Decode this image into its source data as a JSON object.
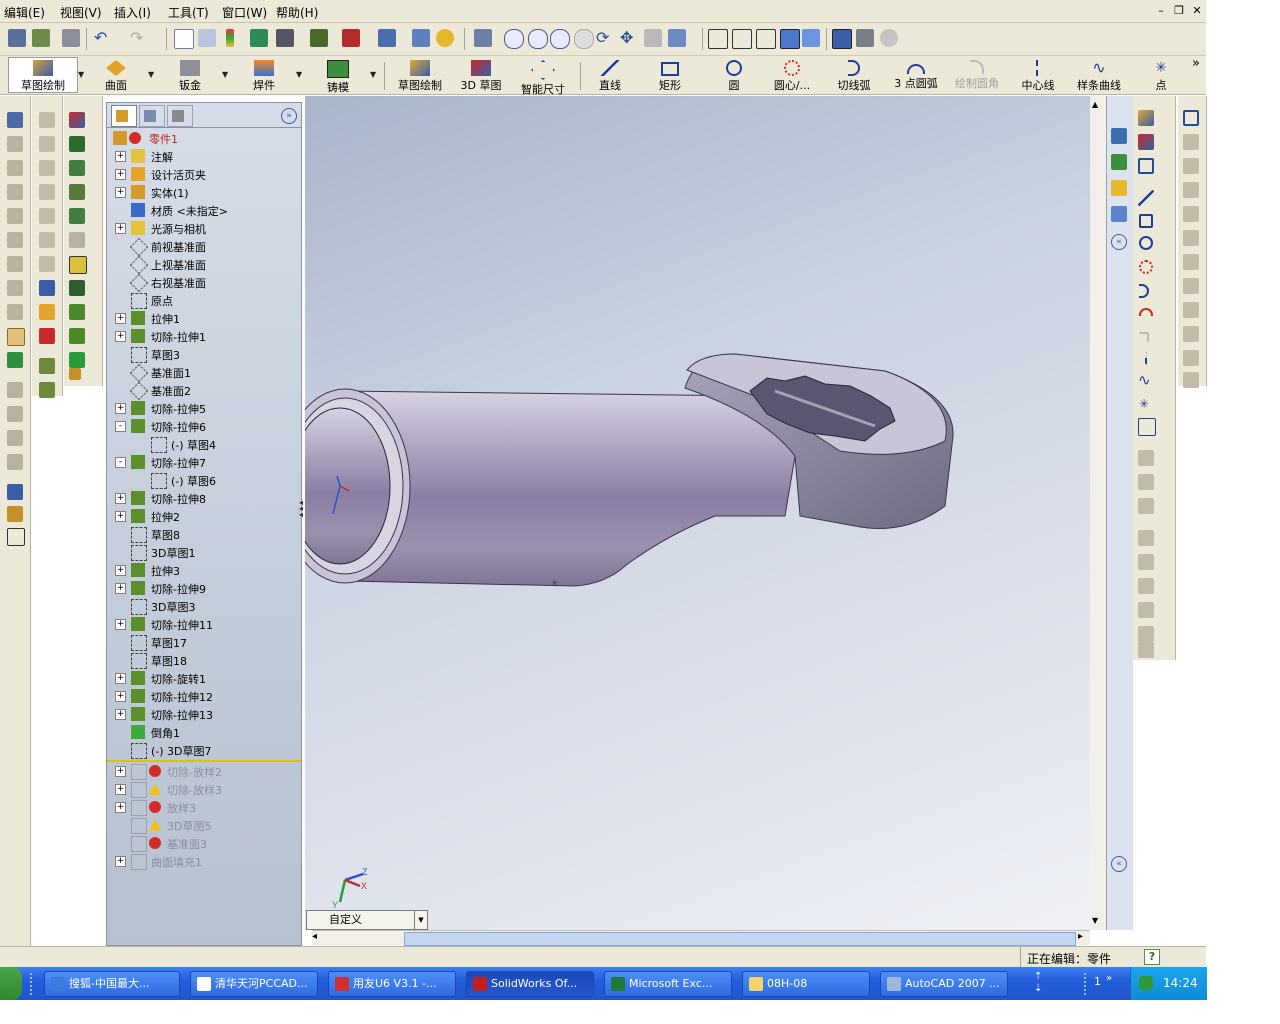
{
  "menu": [
    "编辑(E)",
    "视图(V)",
    "插入(I)",
    "工具(T)",
    "窗口(W)",
    "帮助(H)"
  ],
  "command_manager": {
    "tabs": [
      "草图绘制",
      "曲面",
      "钣金",
      "焊件",
      "铸模"
    ],
    "sketch_tools": [
      "草图绘制",
      "3D 草图",
      "智能尺寸",
      "直线",
      "矩形",
      "圆",
      "圆心/...",
      "切线弧",
      "3 点圆弧",
      "绘制圆角",
      "中心线",
      "样条曲线",
      "点"
    ],
    "disabled_tool": "绘制圆角",
    "more": "»"
  },
  "feature_tree": {
    "root": "零件1",
    "items": [
      {
        "label": "注解",
        "exp": "+",
        "icon": "annotation"
      },
      {
        "label": "设计活页夹",
        "exp": "+",
        "icon": "binder"
      },
      {
        "label": "实体(1)",
        "exp": "+",
        "icon": "solid"
      },
      {
        "label": "材质 <未指定>",
        "exp": "",
        "icon": "material"
      },
      {
        "label": "光源与相机",
        "exp": "+",
        "icon": "lights"
      },
      {
        "label": "前视基准面",
        "exp": "",
        "icon": "plane"
      },
      {
        "label": "上视基准面",
        "exp": "",
        "icon": "plane"
      },
      {
        "label": "右视基准面",
        "exp": "",
        "icon": "plane"
      },
      {
        "label": "原点",
        "exp": "",
        "icon": "origin"
      },
      {
        "label": "拉伸1",
        "exp": "+",
        "icon": "extrude"
      },
      {
        "label": "切除-拉伸1",
        "exp": "+",
        "icon": "cut"
      },
      {
        "label": "草图3",
        "exp": "",
        "icon": "sketch"
      },
      {
        "label": "基准面1",
        "exp": "",
        "icon": "plane"
      },
      {
        "label": "基准面2",
        "exp": "",
        "icon": "plane"
      },
      {
        "label": "切除-拉伸5",
        "exp": "+",
        "icon": "cut"
      },
      {
        "label": "切除-拉伸6",
        "exp": "-",
        "icon": "cut"
      },
      {
        "label": "(-) 草图4",
        "exp": "",
        "icon": "sketch",
        "indent": 1
      },
      {
        "label": "切除-拉伸7",
        "exp": "-",
        "icon": "cut"
      },
      {
        "label": "(-) 草图6",
        "exp": "",
        "icon": "sketch",
        "indent": 1
      },
      {
        "label": "切除-拉伸8",
        "exp": "+",
        "icon": "cut"
      },
      {
        "label": "拉伸2",
        "exp": "+",
        "icon": "extrude"
      },
      {
        "label": "草图8",
        "exp": "",
        "icon": "sketch"
      },
      {
        "label": "3D草图1",
        "exp": "",
        "icon": "sketch3d"
      },
      {
        "label": "拉伸3",
        "exp": "+",
        "icon": "extrude"
      },
      {
        "label": "切除-拉伸9",
        "exp": "+",
        "icon": "cut"
      },
      {
        "label": "3D草图3",
        "exp": "",
        "icon": "sketch3d"
      },
      {
        "label": "切除-拉伸11",
        "exp": "+",
        "icon": "cut"
      },
      {
        "label": "草图17",
        "exp": "",
        "icon": "sketch"
      },
      {
        "label": "草图18",
        "exp": "",
        "icon": "sketch"
      },
      {
        "label": "切除-旋转1",
        "exp": "+",
        "icon": "revolve"
      },
      {
        "label": "切除-拉伸12",
        "exp": "+",
        "icon": "cut"
      },
      {
        "label": "切除-拉伸13",
        "exp": "+",
        "icon": "cut"
      },
      {
        "label": "倒角1",
        "exp": "",
        "icon": "chamfer"
      },
      {
        "label": "(-) 3D草图7",
        "exp": "",
        "icon": "sketch3d"
      }
    ],
    "rolled_back": [
      {
        "label": "切除-放样2",
        "exp": "+",
        "status": "error"
      },
      {
        "label": "切除-放样3",
        "exp": "+",
        "status": "warning"
      },
      {
        "label": "放样3",
        "exp": "+",
        "status": "error"
      },
      {
        "label": "3D草图5",
        "exp": "",
        "status": "warning"
      },
      {
        "label": "基准面3",
        "exp": "",
        "status": "error"
      },
      {
        "label": "曲面填充1",
        "exp": "+",
        "status": ""
      }
    ]
  },
  "viewport": {
    "view_orientation": "自定义"
  },
  "status": {
    "editing": "正在编辑：零件",
    "help": "?"
  },
  "taskbar": {
    "tasks": [
      {
        "label": "搜狐-中国最大...",
        "color": "#3a7be0"
      },
      {
        "label": "清华天河PCCAD...",
        "color": "#ffffff"
      },
      {
        "label": "用友U6 V3.1 -...",
        "color": "#d03030"
      },
      {
        "label": "SolidWorks Of...",
        "color": "#c81e1e",
        "active": true
      },
      {
        "label": "Microsoft Exc...",
        "color": "#1f7a3a"
      },
      {
        "label": "08H-08",
        "color": "#f3d36b"
      },
      {
        "label": "AutoCAD 2007 ...",
        "color": "#9fb7d8"
      }
    ],
    "tray_count": "1",
    "clock": "14:24"
  }
}
